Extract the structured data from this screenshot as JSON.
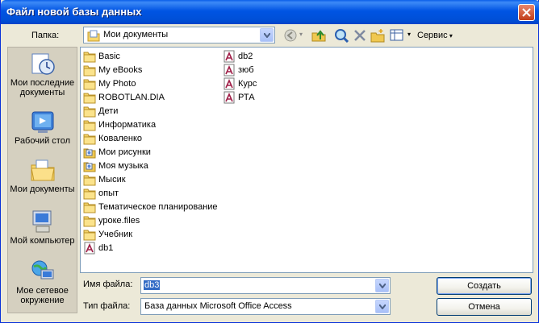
{
  "window": {
    "title": "Файл новой базы данных"
  },
  "toolbar": {
    "folder_label": "Папка:",
    "folder_value": "Мои документы",
    "tools_label": "Сервис"
  },
  "places": [
    {
      "label": "Мои последние документы",
      "icon": "recent-documents-icon"
    },
    {
      "label": "Рабочий стол",
      "icon": "desktop-icon"
    },
    {
      "label": "Мои документы",
      "icon": "my-documents-icon"
    },
    {
      "label": "Мой компьютер",
      "icon": "my-computer-icon"
    },
    {
      "label": "Мое сетевое окружение",
      "icon": "network-places-icon"
    }
  ],
  "files_col1": [
    {
      "name": "Basic",
      "type": "folder"
    },
    {
      "name": "My eBooks",
      "type": "folder"
    },
    {
      "name": "My Photo",
      "type": "folder"
    },
    {
      "name": "ROBOTLAN.DIA",
      "type": "folder"
    },
    {
      "name": "Дети",
      "type": "folder"
    },
    {
      "name": "Информатика",
      "type": "folder"
    },
    {
      "name": "Коваленко",
      "type": "folder"
    },
    {
      "name": "Мои рисунки",
      "type": "special-folder"
    },
    {
      "name": "Моя музыка",
      "type": "special-folder"
    },
    {
      "name": "Мысик",
      "type": "folder"
    },
    {
      "name": "опыт",
      "type": "folder"
    },
    {
      "name": "Тематическое планирование",
      "type": "folder"
    },
    {
      "name": "уроке.files",
      "type": "folder"
    },
    {
      "name": "Учебник",
      "type": "folder"
    },
    {
      "name": "db1",
      "type": "access-db"
    }
  ],
  "files_col2": [
    {
      "name": "db2",
      "type": "access-db"
    },
    {
      "name": "зюб",
      "type": "access-db"
    },
    {
      "name": "Курс",
      "type": "access-db"
    },
    {
      "name": "РТА",
      "type": "access-db"
    }
  ],
  "form": {
    "filename_label": "Имя файла:",
    "filename_value": "db3",
    "filetype_label": "Тип файла:",
    "filetype_value": "База данных Microsoft Office Access"
  },
  "buttons": {
    "create": "Создать",
    "cancel": "Отмена"
  }
}
